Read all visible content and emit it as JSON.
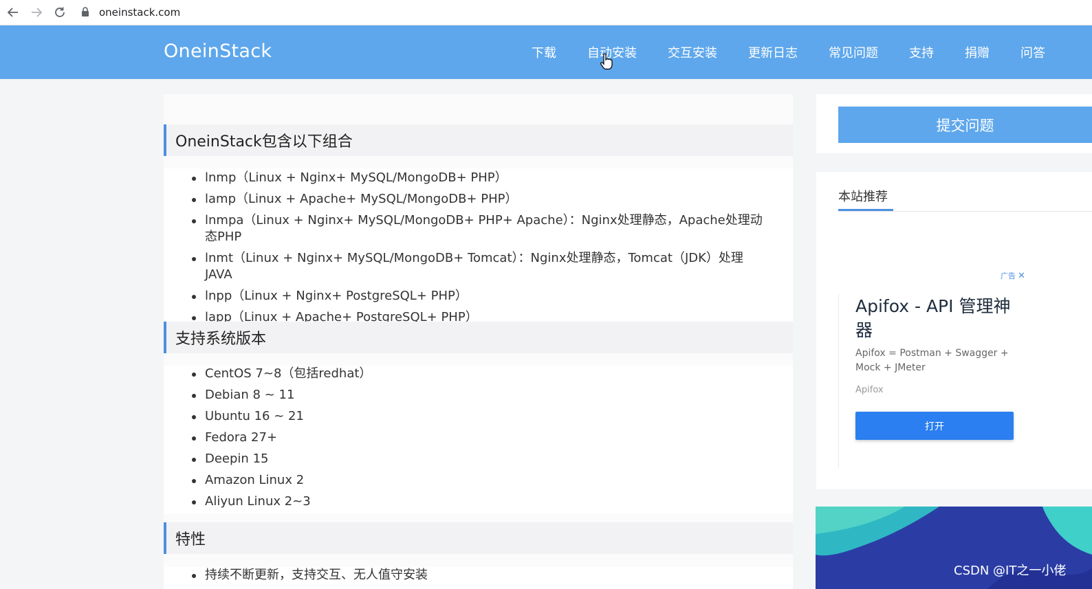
{
  "browser": {
    "url": "oneinstack.com"
  },
  "header": {
    "logo": "OneinStack",
    "nav": [
      "下载",
      "自动安装",
      "交互安装",
      "更新日志",
      "常见问题",
      "支持",
      "捐赠",
      "问答"
    ]
  },
  "sections": [
    {
      "title": "OneinStack包含以下组合",
      "items": [
        "lnmp（Linux + Nginx+ MySQL/MongoDB+ PHP）",
        "lamp（Linux + Apache+ MySQL/MongoDB+ PHP）",
        "lnmpa（Linux + Nginx+ MySQL/MongoDB+ PHP+ Apache）：Nginx处理静态，Apache处理动态PHP",
        "lnmt（Linux + Nginx+ MySQL/MongoDB+ Tomcat）：Nginx处理静态，Tomcat（JDK）处理JAVA",
        "lnpp（Linux + Nginx+ PostgreSQL+ PHP）",
        "lapp（Linux + Apache+ PostgreSQL+ PHP）"
      ]
    },
    {
      "title": "支持系统版本",
      "items": [
        "CentOS 7~8（包括redhat）",
        "Debian 8 ~ 11",
        "Ubuntu 16 ~ 21",
        "Fedora 27+",
        "Deepin 15",
        "Amazon Linux 2",
        "Aliyun Linux 2~3"
      ]
    },
    {
      "title": "特性",
      "items": [
        "持续不断更新，支持交互、无人值守安装"
      ]
    }
  ],
  "sidebar": {
    "submit_button": "提交问题",
    "recommend_title": "本站推荐",
    "ad": {
      "label": "广告",
      "headline": "Apifox - API 管理神器",
      "description": "Apifox = Postman + Swagger + Mock + JMeter",
      "source": "Apifox",
      "button": "打开"
    }
  },
  "watermark": "CSDN @IT之一小佬",
  "colors": {
    "header_bg": "#5ea7ec",
    "accent": "#4a90e2",
    "ad_button": "#2b7ff0"
  }
}
